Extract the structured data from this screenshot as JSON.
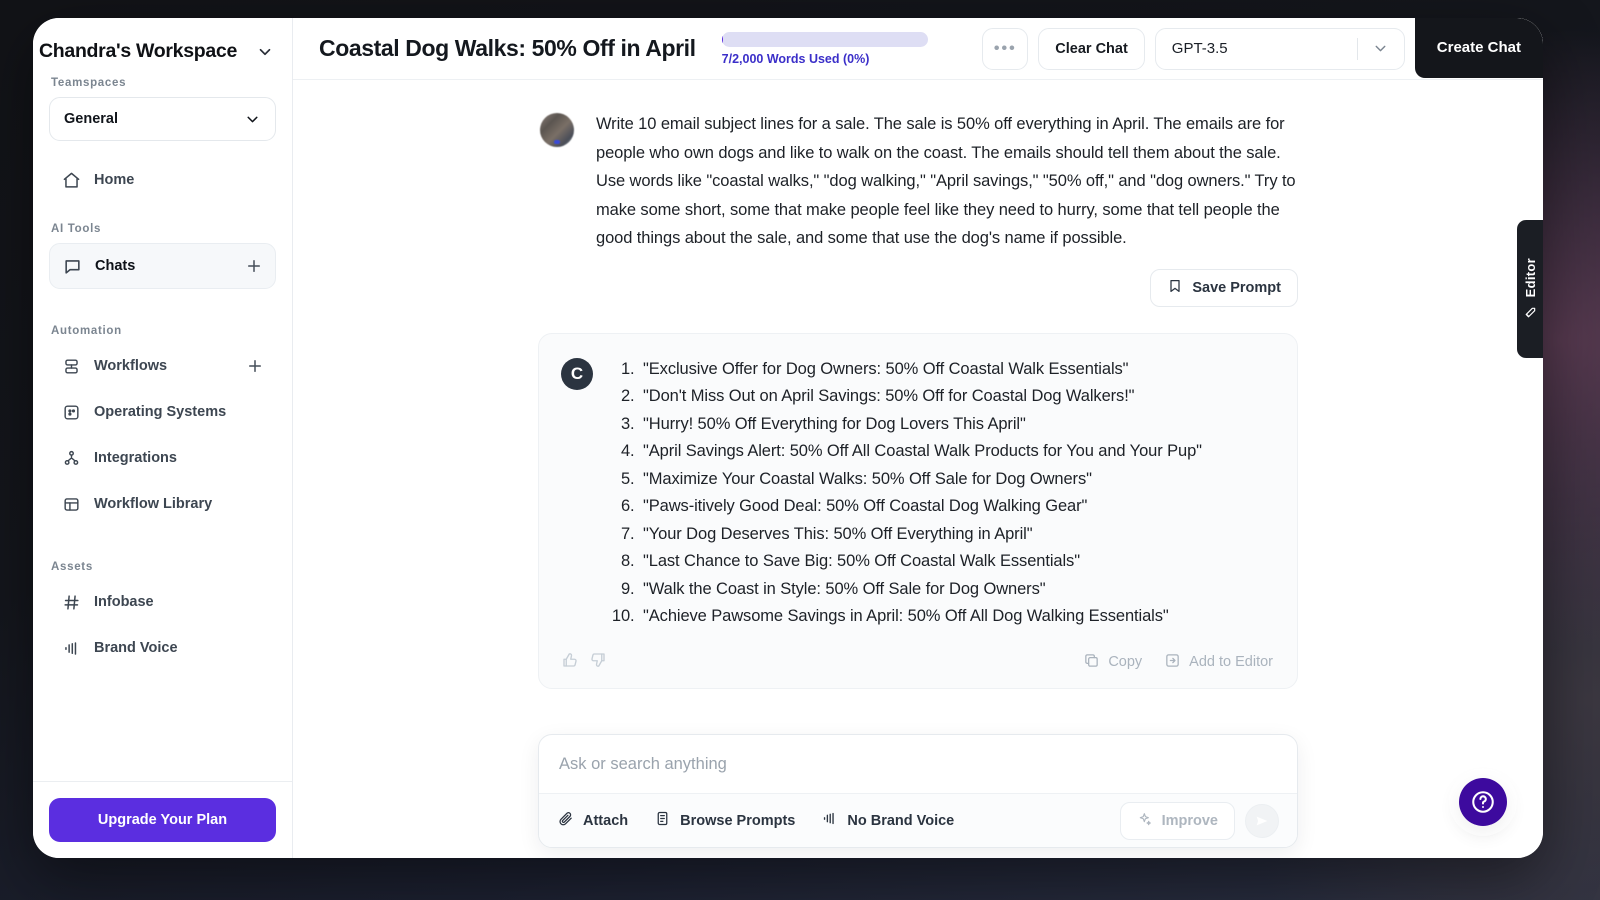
{
  "sidebar": {
    "workspace_name": "Chandra's Workspace",
    "teamspaces_label": "Teamspaces",
    "teamspace_selected": "General",
    "home_label": "Home",
    "ai_tools_label": "AI Tools",
    "chats_label": "Chats",
    "automation_label": "Automation",
    "workflows_label": "Workflows",
    "operating_systems_label": "Operating Systems",
    "integrations_label": "Integrations",
    "workflow_library_label": "Workflow Library",
    "assets_label": "Assets",
    "infobase_label": "Infobase",
    "brand_voice_label": "Brand Voice",
    "upgrade_label": "Upgrade Your Plan",
    "accent_color": "#5b2ee0"
  },
  "topbar": {
    "chat_title": "Coastal Dog Walks: 50% Off in April",
    "words_used_text": "7/2,000 Words Used (0%)",
    "words_used_percent": 0,
    "words_bar_color": "#dedef4",
    "words_text_color": "#3b2fc9",
    "more_label": "•••",
    "clear_chat_label": "Clear Chat",
    "model_selected": "GPT-3.5",
    "create_chat_label": "Create Chat"
  },
  "conversation": {
    "user_message": "Write 10 email subject lines for a sale. The sale is 50% off everything in April. The emails are for people who own dogs and like to walk on the coast. The emails should tell them about the sale. Use words like \"coastal walks,\" \"dog walking,\" \"April savings,\" \"50% off,\" and \"dog owners.\" Try to make some short, some that make people feel like they need to hurry, some that tell people the good things about the sale, and some that use the dog's name if possible.",
    "save_prompt_label": "Save Prompt",
    "assistant_avatar_letter": "C",
    "assistant_list": [
      "\"Exclusive Offer for Dog Owners: 50% Off Coastal Walk Essentials\"",
      "\"Don't Miss Out on April Savings: 50% Off for Coastal Dog Walkers!\"",
      "\"Hurry! 50% Off Everything for Dog Lovers This April\"",
      "\"April Savings Alert: 50% Off All Coastal Walk Products for You and Your Pup\"",
      "\"Maximize Your Coastal Walks: 50% Off Sale for Dog Owners\"",
      "\"Paws-itively Good Deal: 50% Off Coastal Dog Walking Gear\"",
      "\"Your Dog Deserves This: 50% Off Everything in April\"",
      "\"Last Chance to Save Big: 50% Off Coastal Walk Essentials\"",
      "\"Walk the Coast in Style: 50% Off Sale for Dog Owners\"",
      "\"Achieve Pawsome Savings in April: 50% Off All Dog Walking Essentials\""
    ],
    "copy_label": "Copy",
    "add_to_editor_label": "Add to Editor"
  },
  "composer": {
    "placeholder": "Ask or search anything",
    "value": "",
    "attach_label": "Attach",
    "browse_prompts_label": "Browse Prompts",
    "brand_voice_label": "No Brand Voice",
    "improve_label": "Improve"
  },
  "editor_tab": {
    "label": "Editor"
  },
  "help": {
    "label": "?"
  }
}
